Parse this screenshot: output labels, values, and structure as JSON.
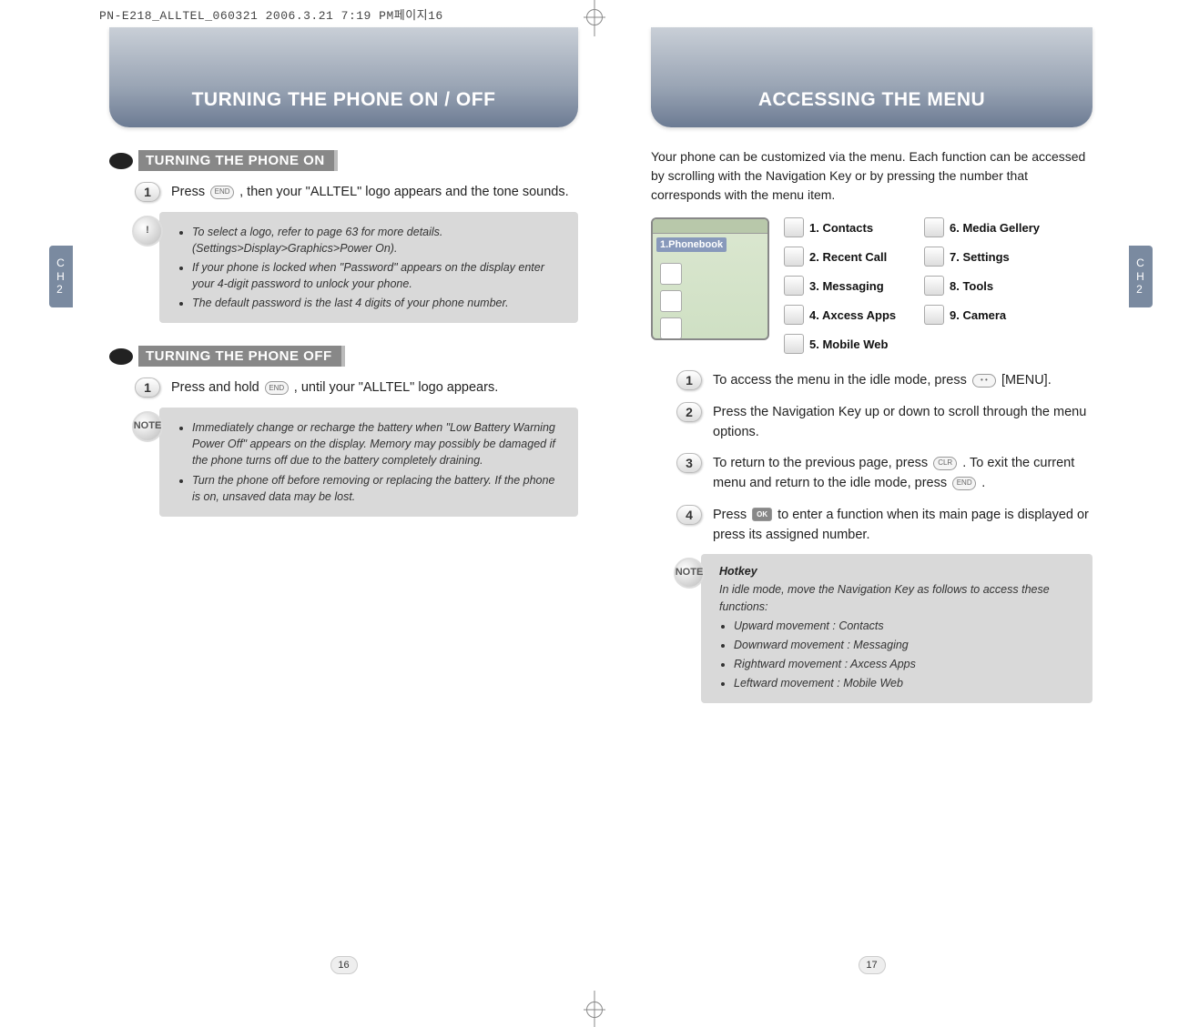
{
  "meta_line": "PN-E218_ALLTEL_060321  2006.3.21 7:19 PM페이지16",
  "chapter_tab": "CH2",
  "left": {
    "banner": "TURNING THE PHONE ON / OFF",
    "section_on": "TURNING THE PHONE ON",
    "step_on_1_a": "Press ",
    "step_on_1_b": " , then your \"ALLTEL\" logo appears and the tone sounds.",
    "note1": [
      "To select a logo, refer to page 63 for more details. (Settings>Display>Graphics>Power On).",
      "If your phone is locked when \"Password\" appears on the display enter your 4-digit password to unlock your phone.",
      "The default password is the last 4 digits of your phone number."
    ],
    "note1_badge": "!",
    "section_off": "TURNING THE PHONE OFF",
    "step_off_1_a": "Press and hold ",
    "step_off_1_b": " , until your \"ALLTEL\" logo appears.",
    "note2_badge": "NOTE",
    "note2": [
      "Immediately change or recharge the battery when \"Low Battery Warning Power Off\" appears on the display. Memory may possibly be damaged if the phone turns off due to the battery completely draining.",
      "Turn the phone off before removing or replacing the battery. If the phone is on, unsaved data may be lost."
    ],
    "page_number": "16"
  },
  "right": {
    "banner": "ACCESSING THE MENU",
    "intro": "Your phone can be customized via the menu. Each function can be accessed by scrolling with the Navigation Key or by pressing the number that corresponds with the menu item.",
    "phone_screen_label": "1.Phonebook",
    "menu_items_col1": [
      "1. Contacts",
      "2. Recent Call",
      "3. Messaging",
      "4. Axcess Apps",
      "5. Mobile Web"
    ],
    "menu_items_col2": [
      "6. Media Gellery",
      "7. Settings",
      "8. Tools",
      "9. Camera"
    ],
    "step1_a": "To access the menu in the idle mode, press ",
    "step1_b": " [MENU].",
    "step2": "Press the Navigation Key up or down to scroll through the menu options.",
    "step3_a": "To return to the previous page, press ",
    "step3_b": ". To exit the current menu and return to the idle mode, press ",
    "step3_c": " .",
    "step4_a": "Press ",
    "step4_b": " to enter a function when its main page is displayed or press its assigned number.",
    "note_badge": "NOTE",
    "note_title": "Hotkey",
    "note_intro": "In idle mode, move the Navigation Key as follows to access these functions:",
    "note_items": [
      "Upward movement : Contacts",
      "Downward movement : Messaging",
      "Rightward movement : Axcess Apps",
      "Leftward movement : Mobile Web"
    ],
    "page_number": "17"
  },
  "keys": {
    "end": "END",
    "menu": "• •",
    "clr": "CLR",
    "ok": "OK"
  }
}
